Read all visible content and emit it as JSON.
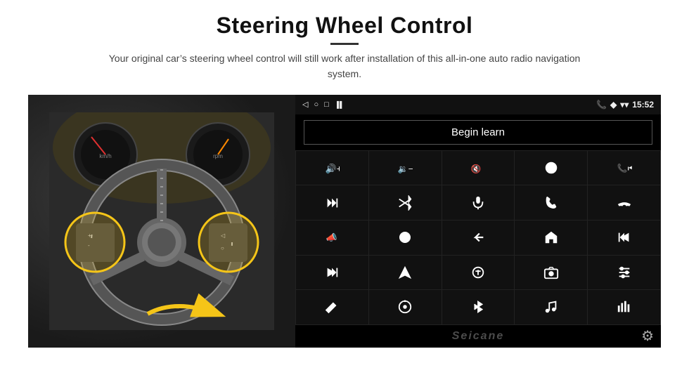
{
  "header": {
    "title": "Steering Wheel Control",
    "subtitle": "Your original car’s steering wheel control will still work after installation of this all-in-one auto radio navigation system."
  },
  "status_bar": {
    "back_icon": "◁",
    "circle_icon": "○",
    "square_icon": "□",
    "signal_icon": "‖▊",
    "phone_icon": "☎",
    "location_icon": "❖",
    "wifi_icon": "▾▾",
    "time": "15:52"
  },
  "begin_learn": {
    "label": "Begin learn"
  },
  "controls": [
    {
      "icon": "vol-up",
      "symbol": ""
    },
    {
      "icon": "vol-down",
      "symbol": ""
    },
    {
      "icon": "mute",
      "symbol": ""
    },
    {
      "icon": "power",
      "symbol": ""
    },
    {
      "icon": "prev-track",
      "symbol": ""
    },
    {
      "icon": "skip-forward",
      "symbol": ""
    },
    {
      "icon": "shuffle",
      "symbol": ""
    },
    {
      "icon": "mic",
      "symbol": ""
    },
    {
      "icon": "phone",
      "symbol": ""
    },
    {
      "icon": "hang-up",
      "symbol": ""
    },
    {
      "icon": "horn",
      "symbol": ""
    },
    {
      "icon": "360-view",
      "symbol": ""
    },
    {
      "icon": "back",
      "symbol": ""
    },
    {
      "icon": "home",
      "symbol": ""
    },
    {
      "icon": "rewind",
      "symbol": ""
    },
    {
      "icon": "fast-forward",
      "symbol": ""
    },
    {
      "icon": "navigate",
      "symbol": ""
    },
    {
      "icon": "eq",
      "symbol": ""
    },
    {
      "icon": "camera",
      "symbol": ""
    },
    {
      "icon": "settings-sliders",
      "symbol": ""
    },
    {
      "icon": "pen",
      "symbol": ""
    },
    {
      "icon": "radio",
      "symbol": ""
    },
    {
      "icon": "bluetooth",
      "symbol": ""
    },
    {
      "icon": "music",
      "symbol": ""
    },
    {
      "icon": "equalizer",
      "symbol": ""
    }
  ],
  "watermark": "Seicane",
  "gear_icon": "⚙"
}
